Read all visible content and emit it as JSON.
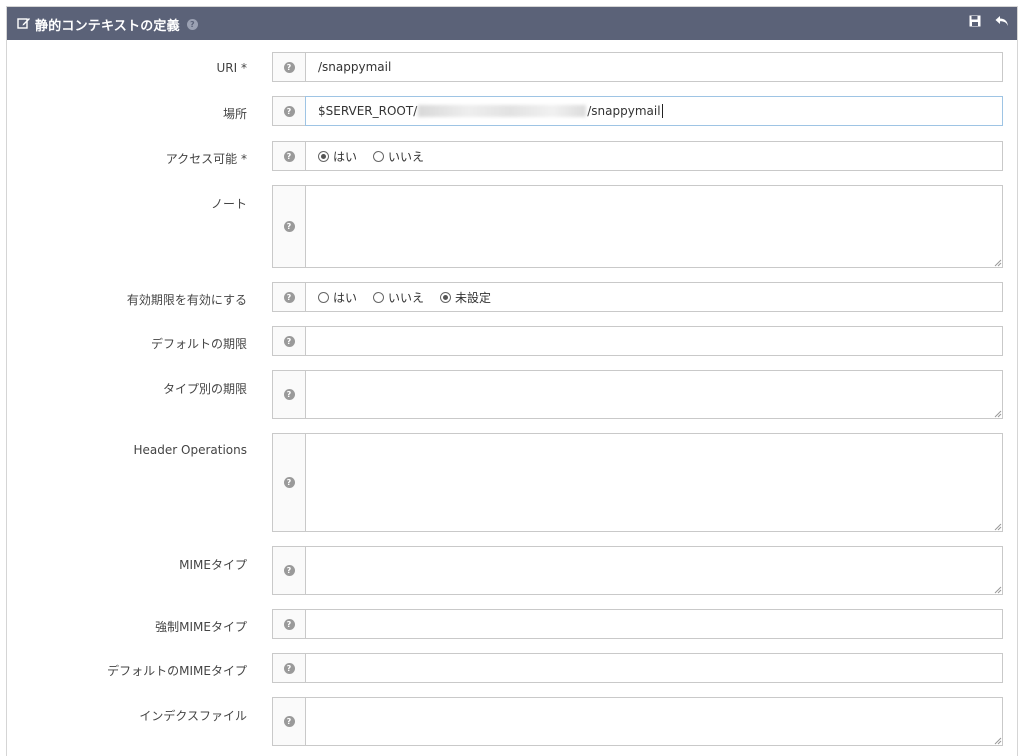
{
  "header": {
    "title": "静的コンテキストの定義",
    "help_icon": "question-circle-icon",
    "save_icon": "save-icon",
    "back_icon": "undo-arrow-icon",
    "bg_color": "#5b6278"
  },
  "fields": {
    "uri": {
      "label": "URI *",
      "value": "/snappymail"
    },
    "location": {
      "label": "場所",
      "value_prefix": "$SERVER_ROOT/",
      "value_suffix": "/snappymail"
    },
    "accessible": {
      "label": "アクセス可能 *",
      "options": [
        "はい",
        "いいえ"
      ],
      "selected": "はい"
    },
    "notes": {
      "label": "ノート",
      "value": ""
    },
    "enable_expires": {
      "label": "有効期限を有効にする",
      "options": [
        "はい",
        "いいえ",
        "未設定"
      ],
      "selected": "未設定"
    },
    "default_expires": {
      "label": "デフォルトの期限",
      "value": ""
    },
    "expires_by_type": {
      "label": "タイプ別の期限",
      "value": ""
    },
    "header_operations": {
      "label": "Header Operations",
      "value": ""
    },
    "mime_type": {
      "label": "MIMEタイプ",
      "value": ""
    },
    "force_mime_type": {
      "label": "強制MIMEタイプ",
      "value": ""
    },
    "default_mime_type": {
      "label": "デフォルトのMIMEタイプ",
      "value": ""
    },
    "index_files": {
      "label": "インデクスファイル",
      "value": ""
    }
  }
}
